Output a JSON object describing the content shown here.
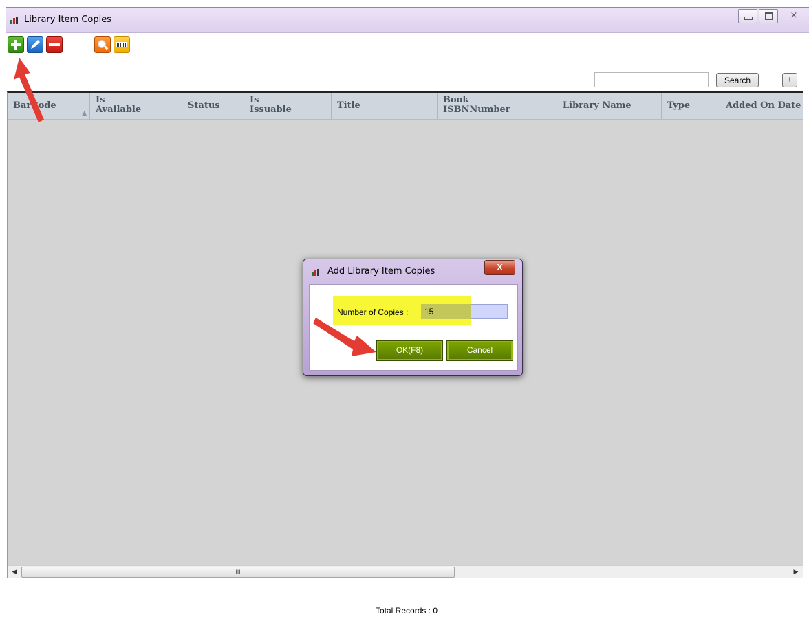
{
  "window": {
    "title": "Library Item Copies"
  },
  "toolbar": {
    "add_icon": "plus-icon",
    "edit_icon": "pencil-icon",
    "delete_icon": "minus-icon",
    "search_icon": "magnifier-icon",
    "barcode_icon": "barcode-icon"
  },
  "search": {
    "value": "",
    "button_label": "Search",
    "extra_label": "!"
  },
  "grid": {
    "columns": [
      {
        "label": "BarCode",
        "sort": "▲"
      },
      {
        "label": "Is\nAvailable"
      },
      {
        "label": "Status"
      },
      {
        "label": "Is\nIssuable"
      },
      {
        "label": "Title"
      },
      {
        "label": "Book\nISBNNumber"
      },
      {
        "label": "Library Name"
      },
      {
        "label": "Type"
      },
      {
        "label": "Added On Date"
      }
    ],
    "scroll_thumb_label": "III"
  },
  "footer": {
    "total_records": "Total Records : 0"
  },
  "dialog": {
    "title": "Add Library Item Copies",
    "close_label": "X",
    "field_label": "Number of Copies :",
    "field_value": "15",
    "ok_label": "OK(F8)",
    "cancel_label": "Cancel"
  },
  "colors": {
    "accent_arrow": "#e23c33",
    "highlight": "#f7f736",
    "dialog_button": "#6b8f00"
  }
}
